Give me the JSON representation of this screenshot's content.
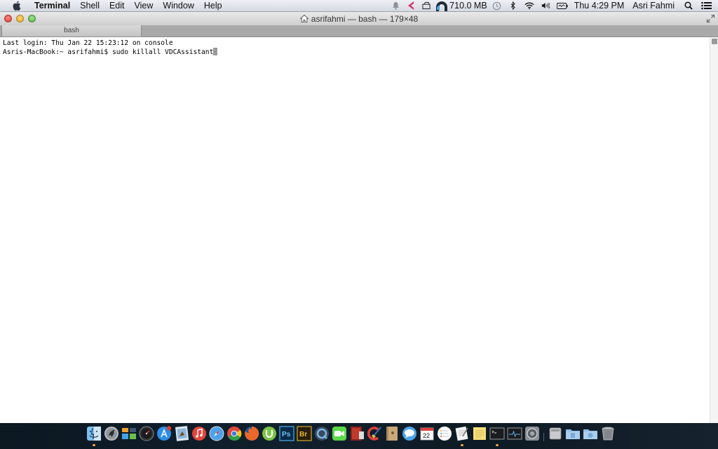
{
  "menubar": {
    "app_name": "Terminal",
    "menus": [
      "Shell",
      "Edit",
      "View",
      "Window",
      "Help"
    ],
    "memory": "710.0 MB",
    "clock": "Thu 4:29 PM",
    "user": "Asri Fahmi",
    "status_icons": [
      "notification-icon",
      "mcafee-icon",
      "drive-icon",
      "memory-monitor-icon",
      "time-machine-icon",
      "bluetooth-icon",
      "wifi-icon",
      "volume-icon",
      "battery-icon",
      "spotlight-icon",
      "notification-center-icon"
    ]
  },
  "window": {
    "title": "asrifahmi — bash — 179×48",
    "tab_label": "bash"
  },
  "terminal": {
    "lines": [
      "Last login: Thu Jan 22 15:23:12 on console",
      "Asris-MacBook:~ asrifahmi$ sudo killall VDCAssistant"
    ]
  },
  "dock": {
    "apps": [
      {
        "name": "Finder",
        "icon": "finder-icon",
        "running": true
      },
      {
        "name": "Launchpad",
        "icon": "launchpad-icon",
        "running": false
      },
      {
        "name": "Mission Control",
        "icon": "mission-control-icon",
        "running": false
      },
      {
        "name": "Dashboard",
        "icon": "dashboard-icon",
        "running": false
      },
      {
        "name": "App Store",
        "icon": "app-store-icon",
        "running": false,
        "badge": "1"
      },
      {
        "name": "Preview",
        "icon": "preview-icon",
        "running": false
      },
      {
        "name": "iTunes",
        "icon": "itunes-icon",
        "running": false
      },
      {
        "name": "Safari",
        "icon": "safari-icon",
        "running": false
      },
      {
        "name": "Chrome",
        "icon": "chrome-icon",
        "running": false
      },
      {
        "name": "Firefox",
        "icon": "firefox-icon",
        "running": false
      },
      {
        "name": "uTorrent",
        "icon": "utorrent-icon",
        "running": false
      },
      {
        "name": "Photoshop",
        "icon": "photoshop-icon",
        "running": false
      },
      {
        "name": "Bridge",
        "icon": "bridge-icon",
        "running": false
      },
      {
        "name": "QuickTime Player",
        "icon": "quicktime-icon",
        "running": false
      },
      {
        "name": "FaceTime",
        "icon": "facetime-icon",
        "running": false
      },
      {
        "name": "Photo Booth",
        "icon": "photo-booth-icon",
        "running": false
      },
      {
        "name": "CCleaner",
        "icon": "ccleaner-icon",
        "running": false
      },
      {
        "name": "Contacts",
        "icon": "contacts-icon",
        "running": false
      },
      {
        "name": "Messages",
        "icon": "messages-icon",
        "running": false
      },
      {
        "name": "Calendar",
        "icon": "calendar-icon",
        "running": false,
        "label": "22"
      },
      {
        "name": "Reminders",
        "icon": "reminders-icon",
        "running": false
      },
      {
        "name": "TextEdit",
        "icon": "textedit-icon",
        "running": true
      },
      {
        "name": "Stickies",
        "icon": "stickies-icon",
        "running": false
      },
      {
        "name": "Terminal",
        "icon": "terminal-icon",
        "running": true
      },
      {
        "name": "Activity Monitor",
        "icon": "activity-monitor-icon",
        "running": false
      },
      {
        "name": "System Preferences",
        "icon": "system-preferences-icon",
        "running": false
      }
    ],
    "stacks": [
      {
        "name": "Macintosh HD",
        "icon": "hard-drive-icon"
      },
      {
        "name": "Documents",
        "icon": "documents-folder-icon"
      },
      {
        "name": "Downloads",
        "icon": "downloads-folder-icon"
      },
      {
        "name": "Trash",
        "icon": "trash-icon"
      }
    ]
  }
}
